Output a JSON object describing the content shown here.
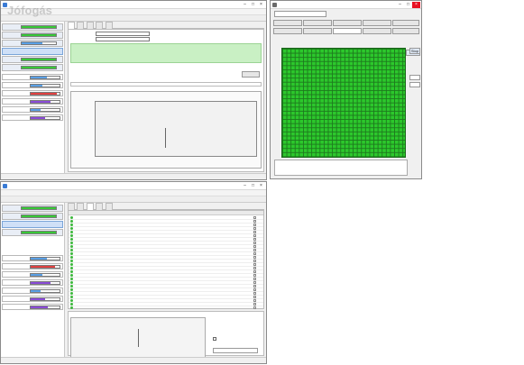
{
  "watermark": "Jófogás",
  "top_window": {
    "title": "",
    "menu": [
      "",
      "",
      "",
      ""
    ],
    "tabs": [
      "",
      "",
      "",
      "",
      ""
    ],
    "status": "",
    "drives": [
      "",
      "",
      "",
      "",
      "",
      "",
      ""
    ]
  },
  "bottom_window": {
    "title": "",
    "menu": [
      "",
      "",
      "",
      ""
    ],
    "tabs": [
      "",
      "",
      "",
      "",
      ""
    ],
    "status": "",
    "drives": [
      "",
      "",
      "",
      "",
      "",
      "",
      ""
    ],
    "smart_rows": [
      "",
      "",
      "",
      "",
      "",
      "",
      "",
      "",
      "",
      "",
      "",
      "",
      "",
      "",
      "",
      "",
      "",
      "",
      "",
      "",
      "",
      "",
      "",
      "",
      "",
      ""
    ]
  },
  "right_window": {
    "title": "",
    "drive_select": "",
    "tools": [
      "",
      "",
      "",
      "",
      "",
      "",
      "",
      "",
      "",
      ""
    ],
    "start_label": "Start",
    "stop_label": "Stop"
  },
  "colors": {
    "green": "#2cc82c",
    "blue": "#5aa0e6",
    "purple": "#8b4bd8",
    "red": "#e04040"
  }
}
